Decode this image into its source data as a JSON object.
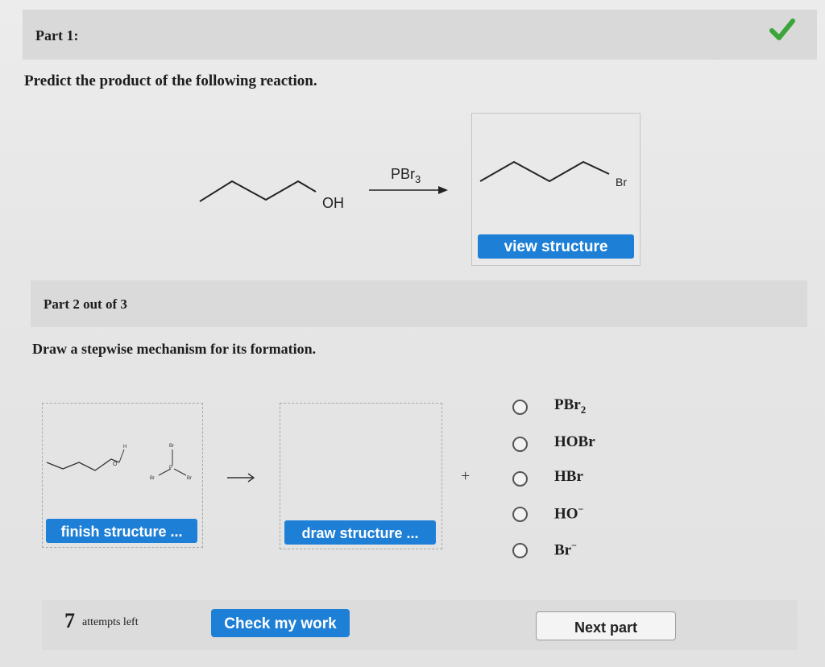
{
  "part1": {
    "title": "Part 1:",
    "question": "Predict the product of the following reaction.",
    "reactant_label": "OH",
    "reagent": "PBr",
    "reagent_sub": "3",
    "product_label": "Br",
    "view_structure_label": "view structure"
  },
  "part2": {
    "title": "Part 2 out of 3",
    "question": "Draw a stepwise mechanism for its formation.",
    "left_labels": {
      "h": "H",
      "o": "O",
      "br_top": "Br",
      "p": "P",
      "br_left": "Br",
      "br_right": "Br"
    },
    "finish_structure_label": "finish structure ...",
    "draw_structure_label": "draw structure ...",
    "plus": "+",
    "options": [
      {
        "text": "PBr",
        "sub": "2",
        "sup": ""
      },
      {
        "text": "HOBr",
        "sub": "",
        "sup": ""
      },
      {
        "text": "HBr",
        "sub": "",
        "sup": ""
      },
      {
        "text": "HO",
        "sub": "",
        "sup": "−"
      },
      {
        "text": "Br",
        "sub": "",
        "sup": "−"
      }
    ]
  },
  "footer": {
    "attempts_count": "7",
    "attempts_text": "attempts left",
    "check_label": "Check my work",
    "next_label": "Next part"
  },
  "colors": {
    "accent": "#1e7fd6",
    "check": "#3aa53a"
  }
}
